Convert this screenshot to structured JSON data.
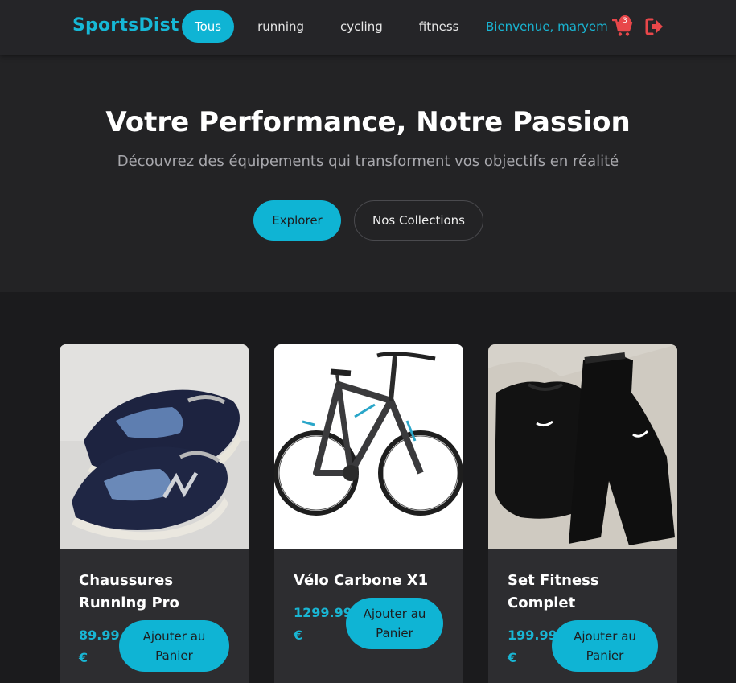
{
  "brand": "SportsDist",
  "nav": {
    "links": [
      "Tous",
      "running",
      "cycling",
      "fitness"
    ],
    "active": "Tous"
  },
  "user": {
    "welcome": "Bienvenue, maryem",
    "cart_count": "3"
  },
  "hero": {
    "title": "Votre Performance, Notre Passion",
    "subtitle": "Découvrez des équipements qui transforment vos objectifs en réalité",
    "explore_label": "Explorer",
    "collections_label": "Nos Collections"
  },
  "products": [
    {
      "name": "Chaussures Running Pro",
      "price_value": "89.99",
      "currency": "€",
      "add_label_1": "Ajouter au",
      "add_label_2": "Panier",
      "image": "sneakers-photo"
    },
    {
      "name": "Vélo Carbone X1",
      "price_value": "1299.99",
      "currency": "€",
      "add_label_1": "Ajouter au",
      "add_label_2": "Panier",
      "image": "bicycle-photo"
    },
    {
      "name": "Set Fitness Complet",
      "price_value": "199.99",
      "currency": "€",
      "add_label_1": "Ajouter au",
      "add_label_2": "Panier",
      "image": "tracksuit-photo"
    }
  ],
  "colors": {
    "accent": "#0fb4d4",
    "background": "#1b1b1d",
    "navbar": "#252528",
    "card": "#2d2d30",
    "danger": "#e8474a"
  },
  "icons": {
    "cart": "shopping-cart-icon",
    "logout": "logout-icon"
  }
}
